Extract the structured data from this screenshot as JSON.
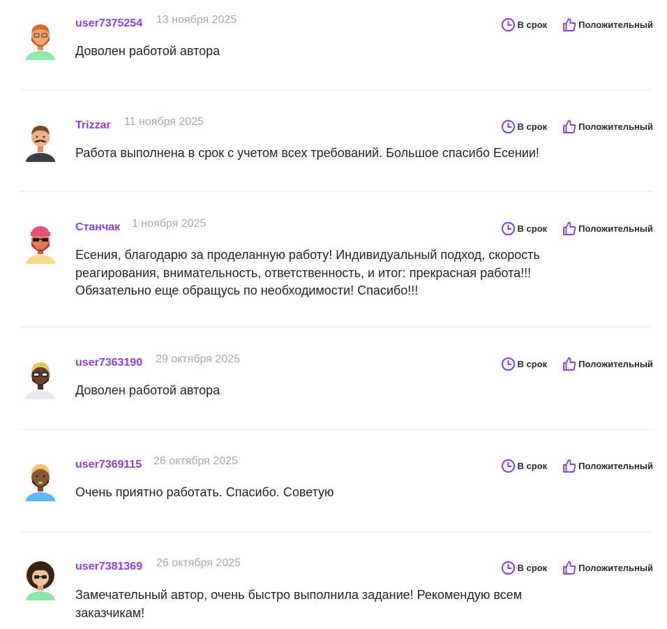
{
  "colors": {
    "accent": "#8a3fe0",
    "date": "#a6a6b6",
    "text": "#222228",
    "divider": "#ececf1"
  },
  "reviews": [
    {
      "user": "user7375254",
      "date": "13 ноября 2025",
      "ontime": "В срок",
      "rating": "Положительный",
      "text": "Доволен работой автора",
      "avatar": "avatar-ginger-beard"
    },
    {
      "user": "Trizzar",
      "date": "11 ноября 2025",
      "ontime": "В срок",
      "rating": "Положительный",
      "text": "Работа выполнена в срок с учетом всех требований. Большое спасибо Есении!",
      "avatar": "avatar-mustache"
    },
    {
      "user": "Станчак",
      "date": "1 ноября 2025",
      "ontime": "В срок",
      "rating": "Положительный",
      "text": "Есения, благодарю за проделанную работу! Индивидуальный подход, скорость реагирования, внимательность, ответственность, и итог: прекрасная работа!!! Обязательно еще обращусь по необходимости! Спасибо!!!",
      "avatar": "avatar-pink-hat-glasses"
    },
    {
      "user": "user7363190",
      "date": "29 октября 2025",
      "ontime": "В срок",
      "rating": "Положительный",
      "text": "Доволен работой автора",
      "avatar": "avatar-blonde-glasses"
    },
    {
      "user": "user7369115",
      "date": "26 октября 2025",
      "ontime": "В срок",
      "rating": "Положительный",
      "text": "Очень приятно работать. Спасибо. Советую",
      "avatar": "avatar-beard-blue-shirt"
    },
    {
      "user": "user7381369",
      "date": "26 октября 2025",
      "ontime": "В срок",
      "rating": "Положительный",
      "text": "Замечательный автор, очень быстро выполнила задание! Рекомендую всем заказчикам!",
      "avatar": "avatar-curly-glasses"
    }
  ]
}
